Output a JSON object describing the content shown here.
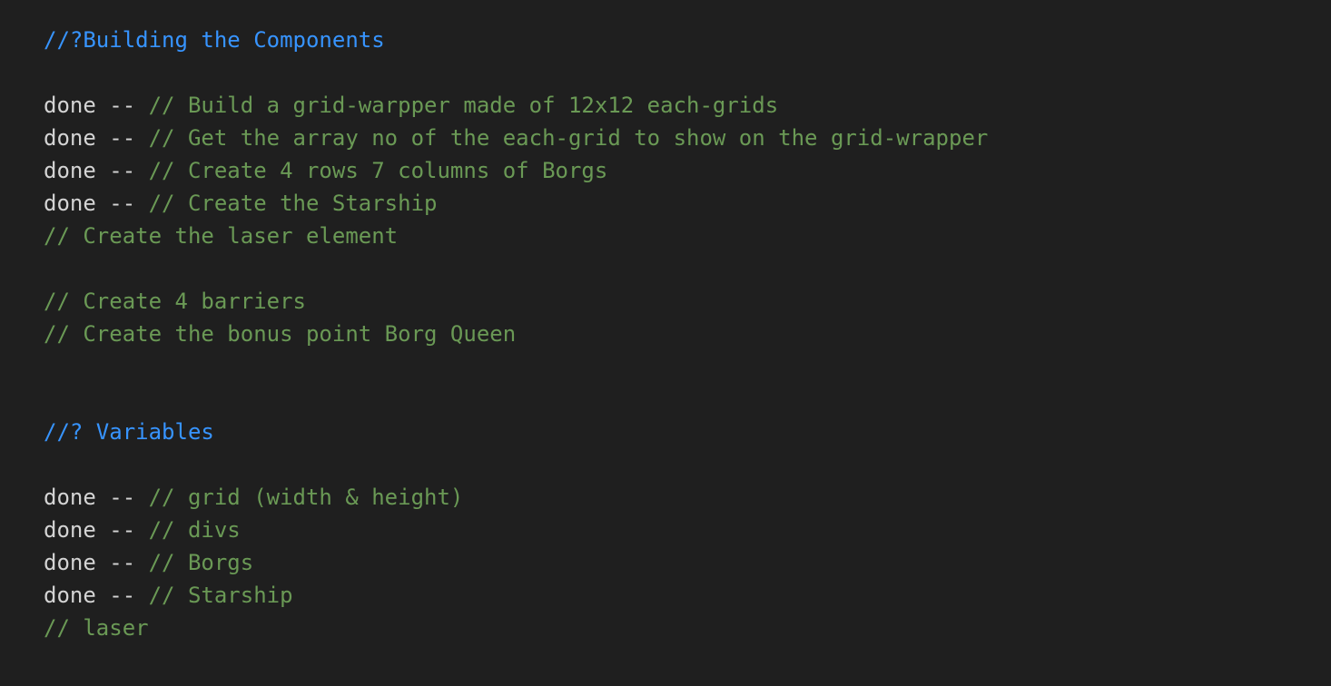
{
  "lines": [
    {
      "plain": "",
      "comment": "",
      "highlight": "//?Building the Components"
    },
    {
      "plain": "",
      "comment": "",
      "highlight": ""
    },
    {
      "plain": "done -- ",
      "comment": "// Build a grid-warpper made of 12x12 each-grids",
      "highlight": ""
    },
    {
      "plain": "done -- ",
      "comment": "// Get the array no of the each-grid to show on the grid-wrapper",
      "highlight": ""
    },
    {
      "plain": "done -- ",
      "comment": "// Create 4 rows 7 columns of Borgs",
      "highlight": ""
    },
    {
      "plain": "done -- ",
      "comment": "// Create the Starship",
      "highlight": ""
    },
    {
      "plain": "",
      "comment": "// Create the laser element",
      "highlight": ""
    },
    {
      "plain": "",
      "comment": "",
      "highlight": ""
    },
    {
      "plain": "",
      "comment": "// Create 4 barriers",
      "highlight": ""
    },
    {
      "plain": "",
      "comment": "// Create the bonus point Borg Queen",
      "highlight": ""
    },
    {
      "plain": "",
      "comment": "",
      "highlight": ""
    },
    {
      "plain": "",
      "comment": "",
      "highlight": ""
    },
    {
      "plain": "",
      "comment": "",
      "highlight": "//? Variables"
    },
    {
      "plain": "",
      "comment": "",
      "highlight": ""
    },
    {
      "plain": "done -- ",
      "comment": "// grid (width & height)",
      "highlight": ""
    },
    {
      "plain": "done -- ",
      "comment": "// divs",
      "highlight": ""
    },
    {
      "plain": "done -- ",
      "comment": "// Borgs",
      "highlight": ""
    },
    {
      "plain": "done -- ",
      "comment": "// Starship",
      "highlight": ""
    },
    {
      "plain": "",
      "comment": "// laser",
      "highlight": ""
    }
  ],
  "colors": {
    "background": "#1f1f1f",
    "plain_text": "#d4d4d4",
    "comment": "#6a9955",
    "highlight_comment": "#3794ff"
  }
}
